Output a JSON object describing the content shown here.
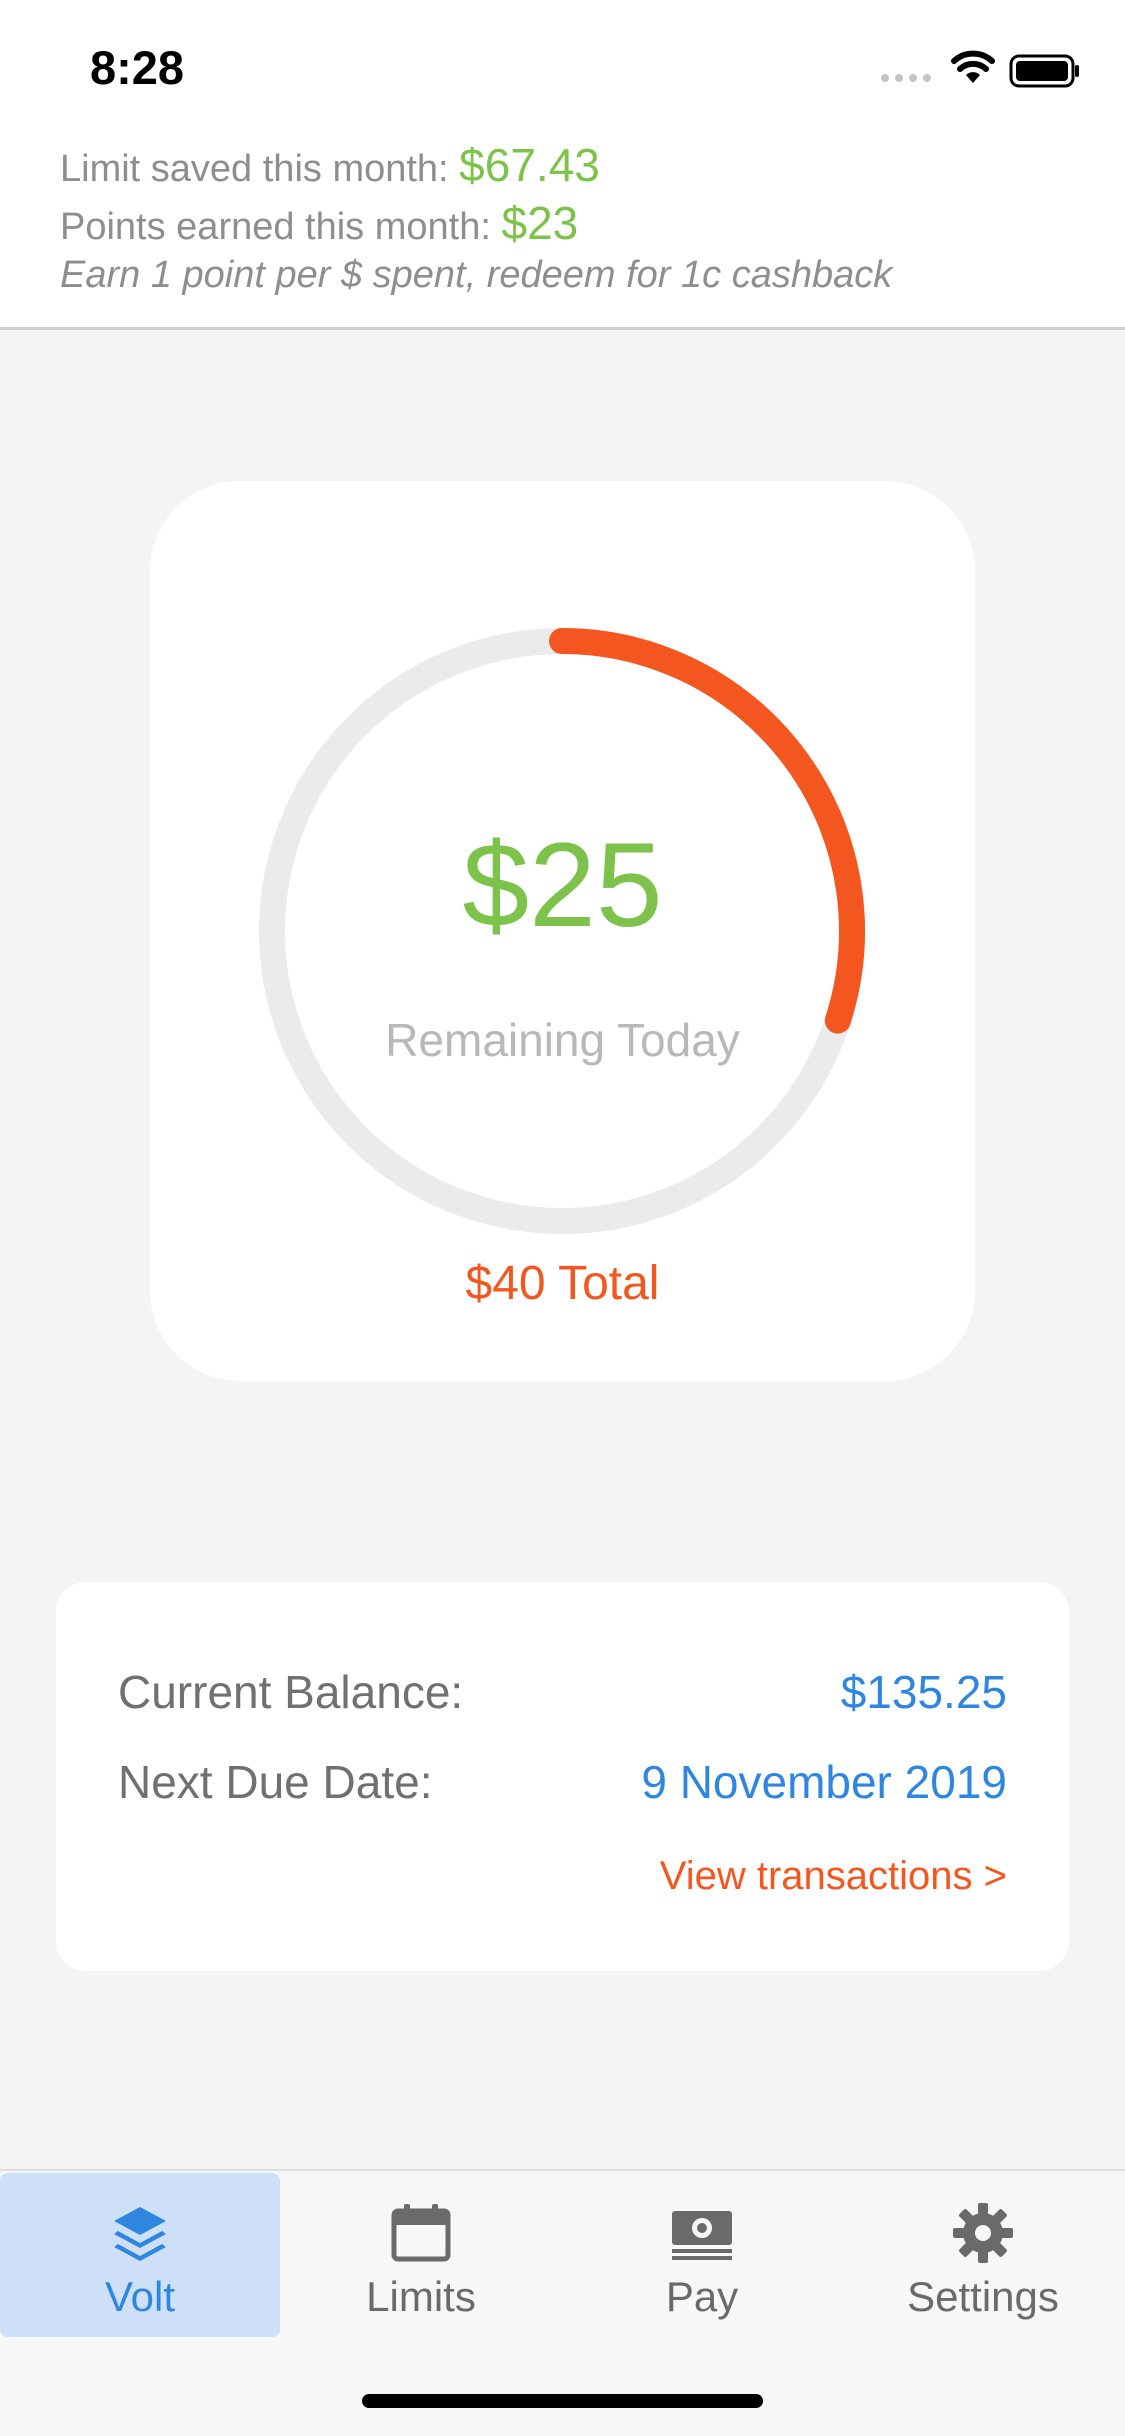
{
  "status_bar": {
    "time": "8:28"
  },
  "summary": {
    "limit_saved_label": "Limit saved this month:",
    "limit_saved_value": "$67.43",
    "points_label": "Points earned this month:",
    "points_value": "$23",
    "note": "Earn 1 point per $ spent, redeem for 1c cashback"
  },
  "gauge": {
    "remaining": "$25",
    "caption": "Remaining Today",
    "total": "$40 Total",
    "spent_fraction": 0.3,
    "track_color": "#ebebeb",
    "progress_color": "#f4561f"
  },
  "balance": {
    "current_label": "Current Balance:",
    "current_value": "$135.25",
    "due_label": "Next Due Date:",
    "due_value": "9 November 2019",
    "view_link": "View transactions >"
  },
  "tabs": [
    {
      "label": "Volt",
      "icon": "layers-icon",
      "active": true
    },
    {
      "label": "Limits",
      "icon": "calendar-icon",
      "active": false
    },
    {
      "label": "Pay",
      "icon": "cash-icon",
      "active": false
    },
    {
      "label": "Settings",
      "icon": "gear-icon",
      "active": false
    }
  ],
  "colors": {
    "accent_green": "#7dc24b",
    "accent_blue": "#2f86e0",
    "accent_orange": "#f4561f"
  }
}
